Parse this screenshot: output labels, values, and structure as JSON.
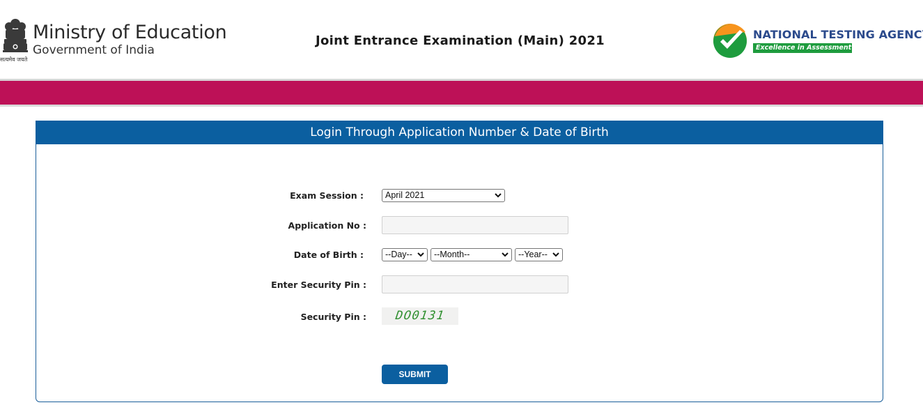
{
  "header": {
    "ministry_title": "Ministry of Education",
    "ministry_subtitle": "Government of India",
    "emblem_motto": "सत्यमेव जयते",
    "exam_title": "Joint Entrance Examination (Main) 2021",
    "agency_name": "NATIONAL TESTING AGENCY",
    "agency_tagline": "Excellence in Assessment"
  },
  "colors": {
    "band": "#bd1157",
    "panel_header": "#0b5fa0",
    "button": "#0b5fa0",
    "nta_green": "#1e9c3e",
    "nta_orange": "#f7941d",
    "nta_blue": "#2b4a8c"
  },
  "icons": {
    "emblem": "state-emblem-icon",
    "nta": "nta-check-logo-icon",
    "dropdown": "chevron-down-icon"
  },
  "form": {
    "title": "Login Through Application Number & Date of Birth",
    "exam_session_label": "Exam Session :",
    "exam_session_value": "April 2021",
    "application_no_label": "Application No :",
    "application_no_value": "",
    "dob_label": "Date of Birth :",
    "dob_day": "--Day--",
    "dob_month": "--Month--",
    "dob_year": "--Year--",
    "security_pin_input_label": "Enter Security Pin :",
    "security_pin_input_value": "",
    "security_pin_label": "Security Pin :",
    "captcha_text": "DO0131",
    "submit_label": "SUBMIT"
  }
}
